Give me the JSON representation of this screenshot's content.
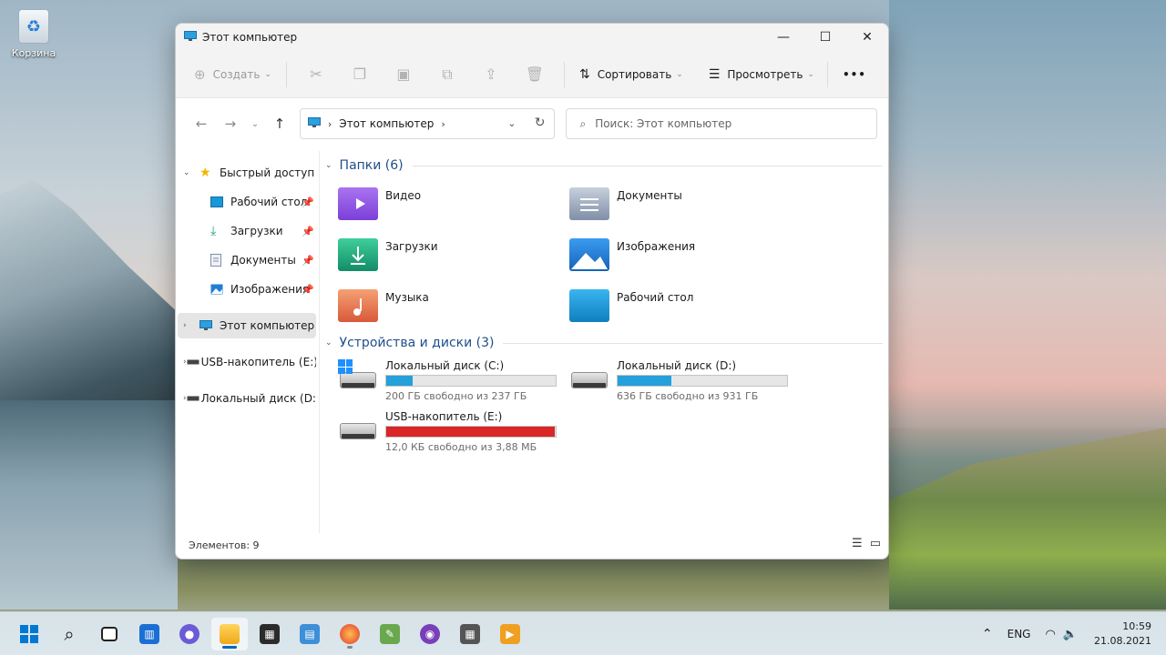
{
  "desktop": {
    "recycle_bin_label": "Корзина"
  },
  "window": {
    "title": "Этот компьютер",
    "controls": {
      "minimize": "—",
      "maximize": "☐",
      "close": "✕"
    }
  },
  "toolbar": {
    "create_label": "Создать",
    "sort_label": "Сортировать",
    "view_label": "Просмотреть",
    "more_label": "•••"
  },
  "address": {
    "crumb": "Этот компьютер",
    "search_placeholder": "Поиск: Этот компьютер"
  },
  "navpane": {
    "quick_access": "Быстрый доступ",
    "items": [
      {
        "label": "Рабочий стол"
      },
      {
        "label": "Загрузки"
      },
      {
        "label": "Документы"
      },
      {
        "label": "Изображения"
      }
    ],
    "this_pc": "Этот компьютер",
    "usb": "USB-накопитель (E:)",
    "local_disk": "Локальный диск (D:)"
  },
  "folders_group": {
    "header": "Папки (6)",
    "items": [
      {
        "name": "Видео",
        "icon": "video-folder-icon",
        "color": "#8a4fe0"
      },
      {
        "name": "Документы",
        "icon": "documents-folder-icon",
        "color": "#7f8fa8"
      },
      {
        "name": "Загрузки",
        "icon": "downloads-folder-icon",
        "color": "#1aa37a"
      },
      {
        "name": "Изображения",
        "icon": "pictures-folder-icon",
        "color": "#1f7fd4"
      },
      {
        "name": "Музыка",
        "icon": "music-folder-icon",
        "color": "#e7784e"
      },
      {
        "name": "Рабочий стол",
        "icon": "desktop-folder-icon",
        "color": "#1898d8"
      }
    ]
  },
  "drives_group": {
    "header": "Устройства и диски (3)",
    "items": [
      {
        "name": "Локальный диск (C:)",
        "free": "200 ГБ свободно из 237 ГБ",
        "used_fraction": 0.156,
        "color": "#26a0da"
      },
      {
        "name": "Локальный диск (D:)",
        "free": "636 ГБ свободно из 931 ГБ",
        "used_fraction": 0.317,
        "color": "#26a0da"
      },
      {
        "name": "USB-накопитель (E:)",
        "free": "12,0 КБ свободно из 3,88 МБ",
        "used_fraction": 0.997,
        "color": "#da2626"
      }
    ]
  },
  "statusbar": {
    "items_count": "Элементов: 9"
  },
  "taskbar": {
    "lang": "ENG",
    "time": "10:59",
    "date": "21.08.2021"
  }
}
